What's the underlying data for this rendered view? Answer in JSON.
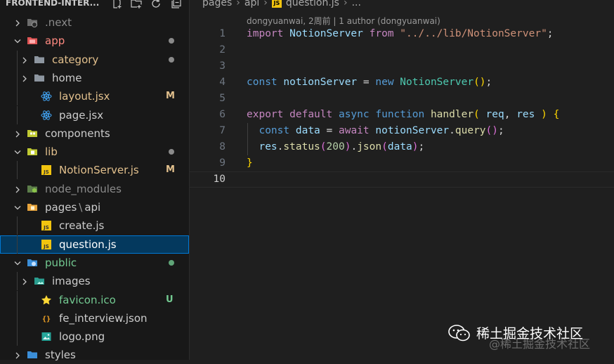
{
  "explorer": {
    "title": "FRONTEND-INTER...",
    "actions": [
      "new-file-icon",
      "new-folder-icon",
      "refresh-icon",
      "collapse-all-icon"
    ]
  },
  "tree": [
    {
      "label": "next",
      "prefix": ".",
      "type": "folder",
      "icon": "next-folder",
      "color": "#8b8b8b",
      "depth": 0,
      "expanded": false,
      "badge": ""
    },
    {
      "label": "app",
      "type": "folder",
      "icon": "app-folder",
      "color": "#ff8a80",
      "depth": 0,
      "expanded": true,
      "badge": "dot"
    },
    {
      "label": "category",
      "type": "folder",
      "icon": "folder",
      "color": "#e2c08d",
      "depth": 1,
      "expanded": false,
      "badge": "dot"
    },
    {
      "label": "home",
      "type": "folder",
      "icon": "folder",
      "color": "#cccccc",
      "depth": 1,
      "expanded": false,
      "badge": ""
    },
    {
      "label": "layout.jsx",
      "type": "file",
      "icon": "react",
      "color": "#e2c08d",
      "depth": 1,
      "badge": "M"
    },
    {
      "label": "page.jsx",
      "type": "file",
      "icon": "react",
      "color": "#cccccc",
      "depth": 1,
      "badge": ""
    },
    {
      "label": "components",
      "type": "folder",
      "icon": "components-folder",
      "color": "#cccccc",
      "depth": 0,
      "expanded": false,
      "badge": ""
    },
    {
      "label": "lib",
      "type": "folder",
      "icon": "lib-folder",
      "color": "#e2c08d",
      "depth": 0,
      "expanded": true,
      "badge": "dot"
    },
    {
      "label": "NotionServer.js",
      "type": "file",
      "icon": "js",
      "color": "#e2c08d",
      "depth": 1,
      "badge": "M"
    },
    {
      "label": "node_modules",
      "type": "folder",
      "icon": "node-folder",
      "color": "#8b8b8b",
      "depth": 0,
      "expanded": false,
      "badge": ""
    },
    {
      "label": "pages",
      "sep": "\\",
      "label2": "api",
      "type": "folder",
      "icon": "pages-folder",
      "color": "#cccccc",
      "depth": 0,
      "expanded": true,
      "badge": ""
    },
    {
      "label": "create.js",
      "type": "file",
      "icon": "js",
      "color": "#cccccc",
      "depth": 1,
      "badge": ""
    },
    {
      "label": "question.js",
      "type": "file",
      "icon": "js",
      "color": "#ffffff",
      "depth": 1,
      "badge": "",
      "selected": true
    },
    {
      "label": "public",
      "type": "folder",
      "icon": "public-folder",
      "color": "#73c991",
      "depth": 0,
      "expanded": true,
      "badge": "dot-green"
    },
    {
      "label": "images",
      "type": "folder",
      "icon": "images-folder",
      "color": "#cccccc",
      "depth": 1,
      "expanded": false,
      "badge": ""
    },
    {
      "label": "favicon.ico",
      "type": "file",
      "icon": "star",
      "color": "#73c991",
      "depth": 1,
      "badge": "U"
    },
    {
      "label": "fe_interview.json",
      "type": "file",
      "icon": "json",
      "color": "#cccccc",
      "depth": 1,
      "badge": ""
    },
    {
      "label": "logo.png",
      "type": "file",
      "icon": "image",
      "color": "#cccccc",
      "depth": 1,
      "badge": ""
    },
    {
      "label": "styles",
      "type": "folder",
      "icon": "styles-folder",
      "color": "#cccccc",
      "depth": 0,
      "expanded": false,
      "badge": ""
    }
  ],
  "breadcrumb": {
    "items": [
      "pages",
      "api",
      "question.js",
      "..."
    ],
    "file_icon": "JS"
  },
  "blame": "dongyuanwai, 2周前 | 1 author (dongyuanwai)",
  "code": [
    {
      "n": "1",
      "tokens": [
        [
          "import",
          "ctl"
        ],
        [
          " ",
          "pl"
        ],
        [
          "NotionServer",
          "var"
        ],
        [
          " ",
          "pl"
        ],
        [
          "from",
          "ctl"
        ],
        [
          " ",
          "pl"
        ],
        [
          "\"../../lib/NotionServer\"",
          "str"
        ],
        [
          ";",
          "pl"
        ]
      ]
    },
    {
      "n": "2",
      "tokens": []
    },
    {
      "n": "3",
      "tokens": []
    },
    {
      "n": "4",
      "tokens": [
        [
          "const",
          "kw"
        ],
        [
          " ",
          "pl"
        ],
        [
          "notionServer",
          "var"
        ],
        [
          " = ",
          "pl"
        ],
        [
          "new",
          "kw"
        ],
        [
          " ",
          "pl"
        ],
        [
          "NotionServer",
          "cls"
        ],
        [
          "()",
          "p1"
        ],
        [
          ";",
          "pl"
        ]
      ]
    },
    {
      "n": "5",
      "tokens": []
    },
    {
      "n": "6",
      "tokens": [
        [
          "export",
          "ctl"
        ],
        [
          " ",
          "pl"
        ],
        [
          "default",
          "ctl"
        ],
        [
          " ",
          "pl"
        ],
        [
          "async",
          "kw"
        ],
        [
          " ",
          "pl"
        ],
        [
          "function",
          "kw"
        ],
        [
          " ",
          "pl"
        ],
        [
          "handler",
          "fn"
        ],
        [
          "(",
          "p1"
        ],
        [
          " ",
          "pl"
        ],
        [
          "req",
          "var"
        ],
        [
          ", ",
          "pl"
        ],
        [
          "res",
          "var"
        ],
        [
          " ",
          "pl"
        ],
        [
          ")",
          "p1"
        ],
        [
          " ",
          "pl"
        ],
        [
          "{",
          "p1"
        ]
      ]
    },
    {
      "n": "7",
      "indent": true,
      "tokens": [
        [
          "  ",
          "pl"
        ],
        [
          "const",
          "kw"
        ],
        [
          " ",
          "pl"
        ],
        [
          "data",
          "var"
        ],
        [
          " = ",
          "pl"
        ],
        [
          "await",
          "ctl"
        ],
        [
          " ",
          "pl"
        ],
        [
          "notionServer",
          "var"
        ],
        [
          ".",
          "pl"
        ],
        [
          "query",
          "fn"
        ],
        [
          "()",
          "p2"
        ],
        [
          ";",
          "pl"
        ]
      ]
    },
    {
      "n": "8",
      "indent": true,
      "tokens": [
        [
          "  ",
          "pl"
        ],
        [
          "res",
          "var"
        ],
        [
          ".",
          "pl"
        ],
        [
          "status",
          "fn"
        ],
        [
          "(",
          "p2"
        ],
        [
          "200",
          "num"
        ],
        [
          ")",
          "p2"
        ],
        [
          ".",
          "pl"
        ],
        [
          "json",
          "fn"
        ],
        [
          "(",
          "p2"
        ],
        [
          "data",
          "var"
        ],
        [
          ")",
          "p2"
        ],
        [
          ";",
          "pl"
        ]
      ]
    },
    {
      "n": "9",
      "tokens": [
        [
          "}",
          "p1"
        ]
      ]
    },
    {
      "n": "10",
      "tokens": [],
      "current": true
    }
  ],
  "watermark": {
    "text": "稀土掘金技术社区",
    "sub": "@稀土掘金技术社区"
  }
}
